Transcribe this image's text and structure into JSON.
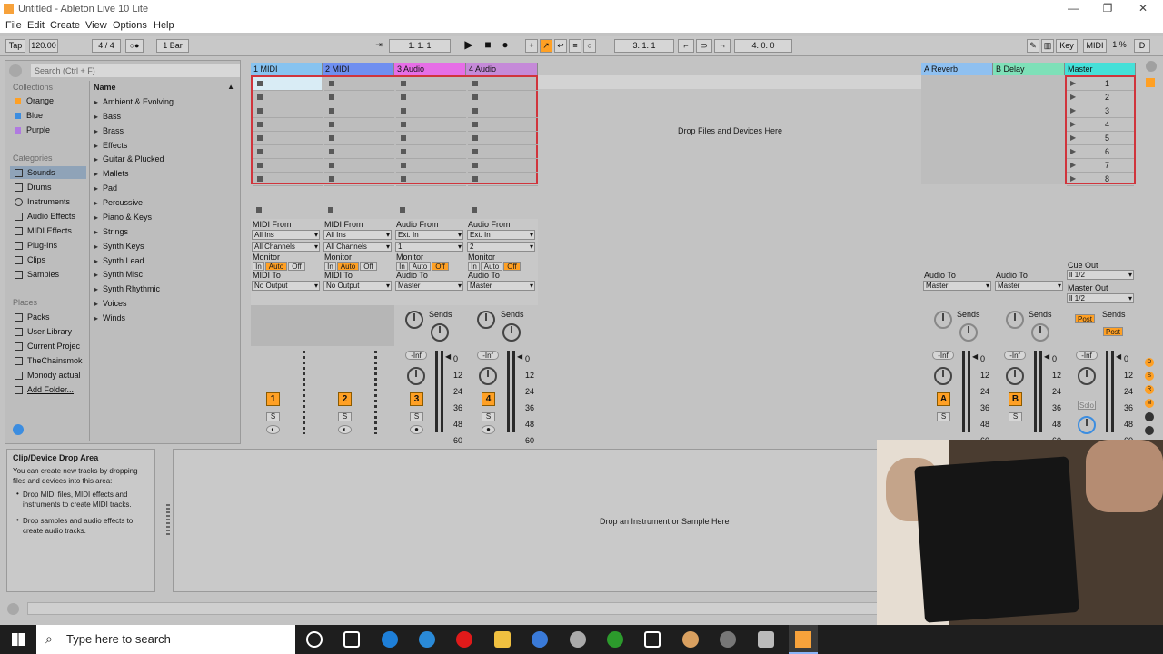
{
  "window": {
    "title": "Untitled - Ableton Live 10 Lite",
    "minimize": "—",
    "maximize": "❐",
    "close": "✕"
  },
  "menu": [
    "File",
    "Edit",
    "Create",
    "View",
    "Options",
    "Help"
  ],
  "control_bar": {
    "tap": "Tap",
    "tempo": "120.00",
    "time_sig": "4 / 4",
    "metro": "○●",
    "quant": "1 Bar",
    "arr_pos": "1.   1.   1",
    "loop_start": "3.   1.   1",
    "loop_len": "4.   0.   0",
    "key": "Key",
    "midi": "MIDI",
    "cpu": "1 %",
    "d": "D"
  },
  "browser": {
    "search_placeholder": "Search (Ctrl + F)",
    "collections_label": "Collections",
    "collections": [
      {
        "label": "Orange",
        "color": "#ffa024"
      },
      {
        "label": "Blue",
        "color": "#3c8de0"
      },
      {
        "label": "Purple",
        "color": "#b07ae0"
      }
    ],
    "categories_label": "Categories",
    "categories": [
      "Sounds",
      "Drums",
      "Instruments",
      "Audio Effects",
      "MIDI Effects",
      "Plug-Ins",
      "Clips",
      "Samples"
    ],
    "places_label": "Places",
    "places": [
      "Packs",
      "User Library",
      "Current Projec",
      "TheChainsmok",
      "Monody actual",
      "Add Folder..."
    ],
    "name_header": "Name",
    "names": [
      "Ambient & Evolving",
      "Bass",
      "Brass",
      "Effects",
      "Guitar & Plucked",
      "Mallets",
      "Pad",
      "Percussive",
      "Piano & Keys",
      "Strings",
      "Synth Keys",
      "Synth Lead",
      "Synth Misc",
      "Synth Rhythmic",
      "Voices",
      "Winds"
    ]
  },
  "tracks": [
    {
      "name": "1 MIDI",
      "color": "#87c3f0",
      "num": "1",
      "type": "midi",
      "from_label": "MIDI From",
      "from": "All Ins",
      "chan": "All Channels",
      "to_label": "MIDI To",
      "to": "No Output"
    },
    {
      "name": "2 MIDI",
      "color": "#6f8ff0",
      "num": "2",
      "type": "midi",
      "from_label": "MIDI From",
      "from": "All Ins",
      "chan": "All Channels",
      "to_label": "MIDI To",
      "to": "No Output"
    },
    {
      "name": "3 Audio",
      "color": "#e66ee6",
      "num": "3",
      "type": "audio",
      "from_label": "Audio From",
      "from": "Ext. In",
      "chan": "1",
      "to_label": "Audio To",
      "to": "Master"
    },
    {
      "name": "4 Audio",
      "color": "#c58ad8",
      "num": "4",
      "type": "audio",
      "from_label": "Audio From",
      "from": "Ext. In",
      "chan": "2",
      "to_label": "Audio To",
      "to": "Master"
    }
  ],
  "returns": [
    {
      "name": "A Reverb",
      "color": "#8fc0f0",
      "letter": "A",
      "to_label": "Audio To",
      "to": "Master"
    },
    {
      "name": "B Delay",
      "color": "#7ee0b8",
      "letter": "B",
      "to_label": "Audio To",
      "to": "Master"
    }
  ],
  "master": {
    "name": "Master",
    "color": "#45e0d8",
    "scenes": [
      "1",
      "2",
      "3",
      "4",
      "5",
      "6",
      "7",
      "8"
    ],
    "cue_label": "Cue Out",
    "cue": "ll 1/2",
    "out_label": "Master Out",
    "out": "ll 1/2",
    "post": "Post",
    "solo": "Solo"
  },
  "mixer": {
    "monitor": "Monitor",
    "in": "In",
    "auto": "Auto",
    "off": "Off",
    "sends": "Sends",
    "inf": "-Inf",
    "s": "S",
    "db": [
      "0",
      "12",
      "24",
      "36",
      "48",
      "60"
    ]
  },
  "drop_files": "Drop Files and Devices Here",
  "info": {
    "title": "Clip/Device Drop Area",
    "body": "You can create new tracks by dropping files and devices into this area:",
    "bullets": [
      "Drop MIDI files, MIDI effects and instruments to create MIDI tracks.",
      "Drop samples and audio effects to create audio tracks."
    ]
  },
  "detail_hint": "Drop an Instrument or Sample Here",
  "taskbar": {
    "search": "Type here to search"
  }
}
